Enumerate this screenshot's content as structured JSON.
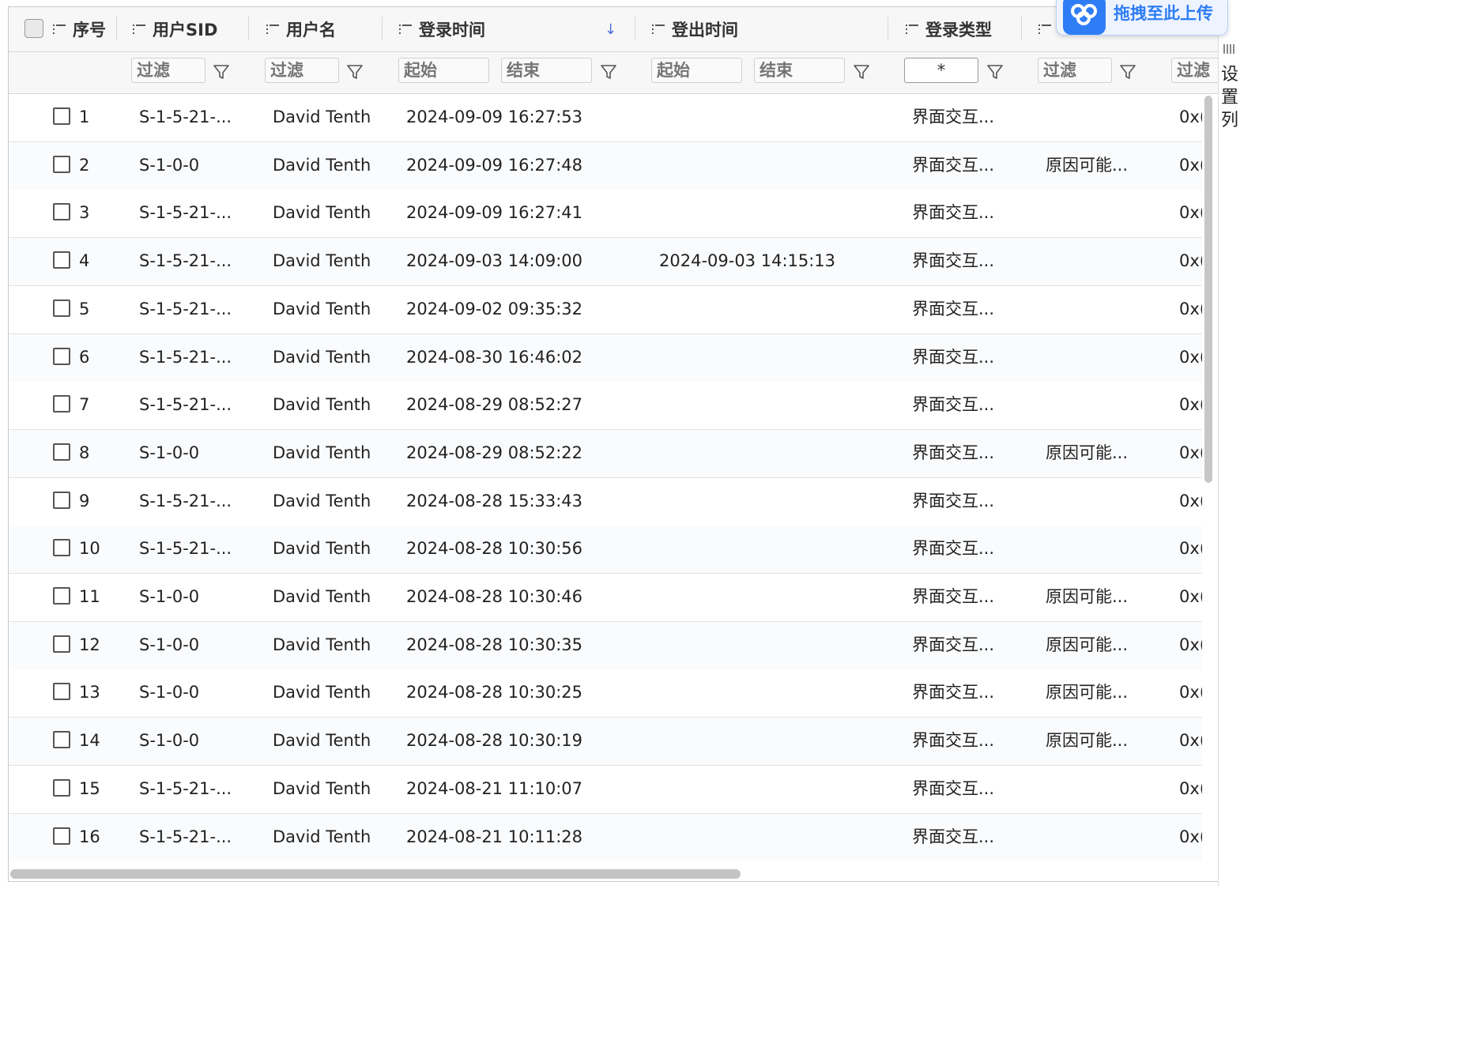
{
  "columns": [
    {
      "key": "seq",
      "label": "序号"
    },
    {
      "key": "sid",
      "label": "用户SID"
    },
    {
      "key": "user",
      "label": "用户名"
    },
    {
      "key": "login",
      "label": "登录时间"
    },
    {
      "key": "logout",
      "label": "登出时间"
    },
    {
      "key": "type",
      "label": "登录类型"
    }
  ],
  "filters": {
    "sid_placeholder": "过滤",
    "user_placeholder": "过滤",
    "login_start": "起始",
    "login_end": "结束",
    "logout_start": "起始",
    "logout_end": "结束",
    "type_value": "*",
    "col7_placeholder": "过滤",
    "col8_placeholder": "过滤"
  },
  "rows": [
    {
      "seq": "1",
      "sid": "S-1-5-21-...",
      "user": "David Tenth",
      "login": "2024-09-09 16:27:53",
      "logout": "",
      "type": "界面交互...",
      "reason": "",
      "extra": "0x("
    },
    {
      "seq": "2",
      "sid": "S-1-0-0",
      "user": "David Tenth",
      "login": "2024-09-09 16:27:48",
      "logout": "",
      "type": "界面交互...",
      "reason": "原因可能...",
      "extra": "0x("
    },
    {
      "seq": "3",
      "sid": "S-1-5-21-...",
      "user": "David Tenth",
      "login": "2024-09-09 16:27:41",
      "logout": "",
      "type": "界面交互...",
      "reason": "",
      "extra": "0x("
    },
    {
      "seq": "4",
      "sid": "S-1-5-21-...",
      "user": "David Tenth",
      "login": "2024-09-03 14:09:00",
      "logout": "2024-09-03 14:15:13",
      "type": "界面交互...",
      "reason": "",
      "extra": "0x("
    },
    {
      "seq": "5",
      "sid": "S-1-5-21-...",
      "user": "David Tenth",
      "login": "2024-09-02 09:35:32",
      "logout": "",
      "type": "界面交互...",
      "reason": "",
      "extra": "0x("
    },
    {
      "seq": "6",
      "sid": "S-1-5-21-...",
      "user": "David Tenth",
      "login": "2024-08-30 16:46:02",
      "logout": "",
      "type": "界面交互...",
      "reason": "",
      "extra": "0x("
    },
    {
      "seq": "7",
      "sid": "S-1-5-21-...",
      "user": "David Tenth",
      "login": "2024-08-29 08:52:27",
      "logout": "",
      "type": "界面交互...",
      "reason": "",
      "extra": "0x("
    },
    {
      "seq": "8",
      "sid": "S-1-0-0",
      "user": "David Tenth",
      "login": "2024-08-29 08:52:22",
      "logout": "",
      "type": "界面交互...",
      "reason": "原因可能...",
      "extra": "0x("
    },
    {
      "seq": "9",
      "sid": "S-1-5-21-...",
      "user": "David Tenth",
      "login": "2024-08-28 15:33:43",
      "logout": "",
      "type": "界面交互...",
      "reason": "",
      "extra": "0x("
    },
    {
      "seq": "10",
      "sid": "S-1-5-21-...",
      "user": "David Tenth",
      "login": "2024-08-28 10:30:56",
      "logout": "",
      "type": "界面交互...",
      "reason": "",
      "extra": "0x("
    },
    {
      "seq": "11",
      "sid": "S-1-0-0",
      "user": "David Tenth",
      "login": "2024-08-28 10:30:46",
      "logout": "",
      "type": "界面交互...",
      "reason": "原因可能...",
      "extra": "0x("
    },
    {
      "seq": "12",
      "sid": "S-1-0-0",
      "user": "David Tenth",
      "login": "2024-08-28 10:30:35",
      "logout": "",
      "type": "界面交互...",
      "reason": "原因可能...",
      "extra": "0x("
    },
    {
      "seq": "13",
      "sid": "S-1-0-0",
      "user": "David Tenth",
      "login": "2024-08-28 10:30:25",
      "logout": "",
      "type": "界面交互...",
      "reason": "原因可能...",
      "extra": "0x("
    },
    {
      "seq": "14",
      "sid": "S-1-0-0",
      "user": "David Tenth",
      "login": "2024-08-28 10:30:19",
      "logout": "",
      "type": "界面交互...",
      "reason": "原因可能...",
      "extra": "0x("
    },
    {
      "seq": "15",
      "sid": "S-1-5-21-...",
      "user": "David Tenth",
      "login": "2024-08-21 11:10:07",
      "logout": "",
      "type": "界面交互...",
      "reason": "",
      "extra": "0x("
    },
    {
      "seq": "16",
      "sid": "S-1-5-21-...",
      "user": "David Tenth",
      "login": "2024-08-21 10:11:28",
      "logout": "",
      "type": "界面交互...",
      "reason": "",
      "extra": "0x("
    }
  ],
  "side_panel": {
    "label": "设置列"
  },
  "upload_badge": {
    "label": "拖拽至此上传"
  },
  "colors": {
    "accent": "#2f7df6",
    "sort_arrow": "#4a6fd8",
    "header_bg": "#f7f7f7",
    "row_border": "#e3e3e3"
  },
  "icons": {
    "column_menu": "list-icon",
    "filter": "funnel-icon",
    "sort": "arrow-down-icon"
  }
}
